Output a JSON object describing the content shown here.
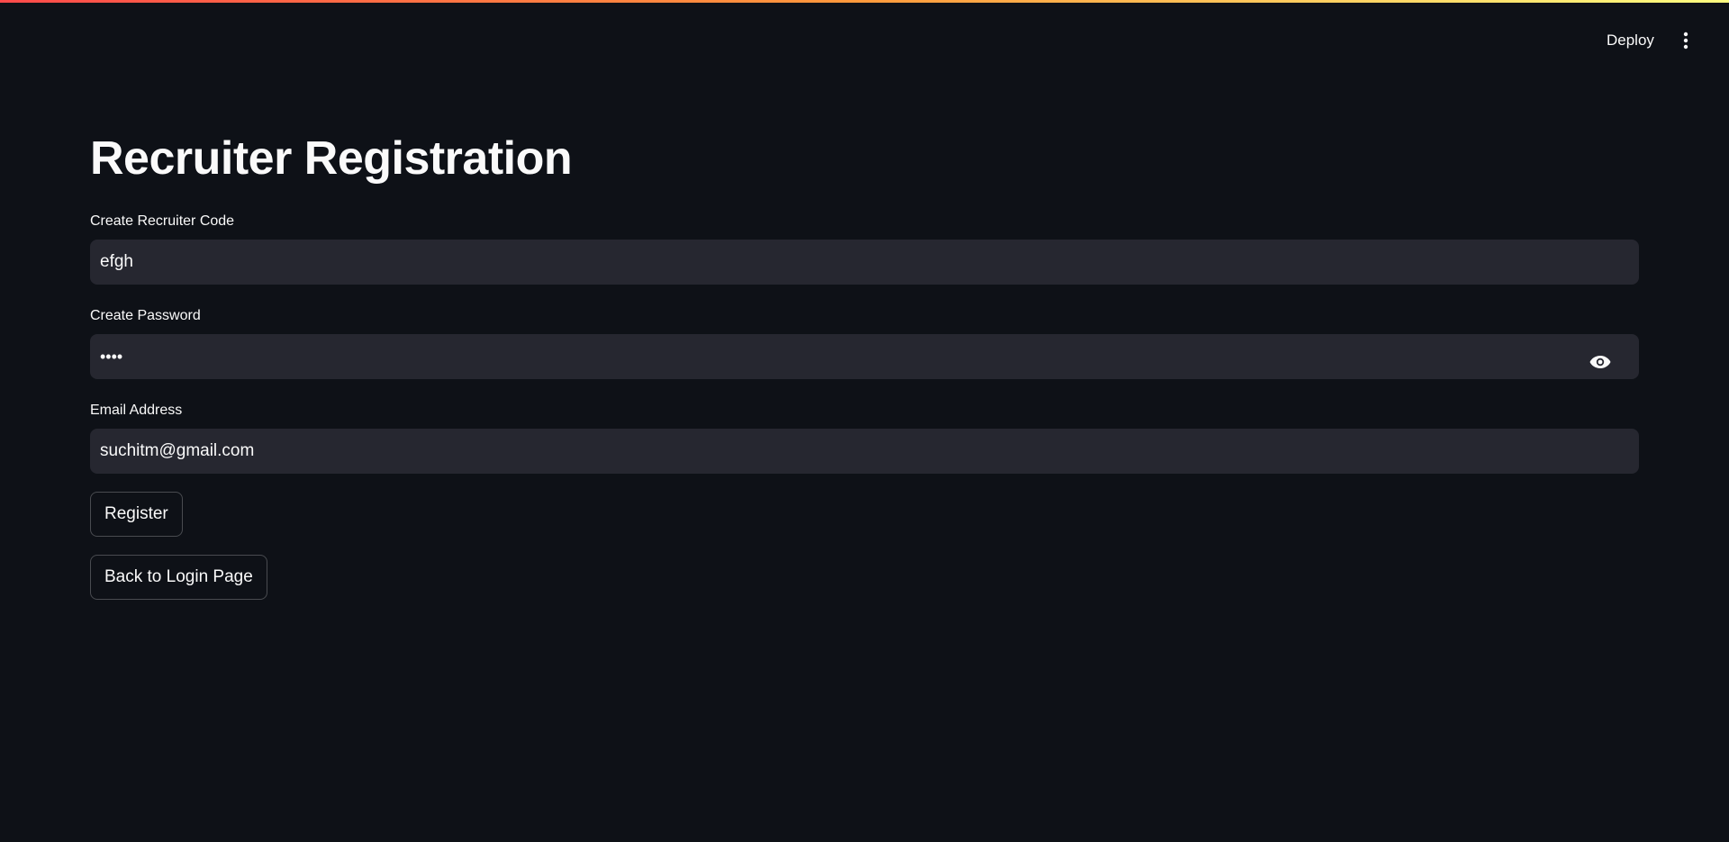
{
  "header": {
    "deploy_label": "Deploy",
    "menu_icon": "more-vertical-icon"
  },
  "main": {
    "title": "Recruiter Registration",
    "fields": {
      "recruiter_code": {
        "label": "Create Recruiter Code",
        "value": "efgh"
      },
      "password": {
        "label": "Create Password",
        "value": "••••",
        "toggle_icon": "eye-icon"
      },
      "email": {
        "label": "Email Address",
        "value": "suchitm@gmail.com"
      }
    },
    "buttons": {
      "register_label": "Register",
      "back_label": "Back to Login Page"
    }
  },
  "colors": {
    "background": "#0e1117",
    "input_background": "#262730",
    "text": "#fafafa",
    "accent_gradient_start": "#ff4b4b",
    "accent_gradient_end": "#fffd80"
  }
}
